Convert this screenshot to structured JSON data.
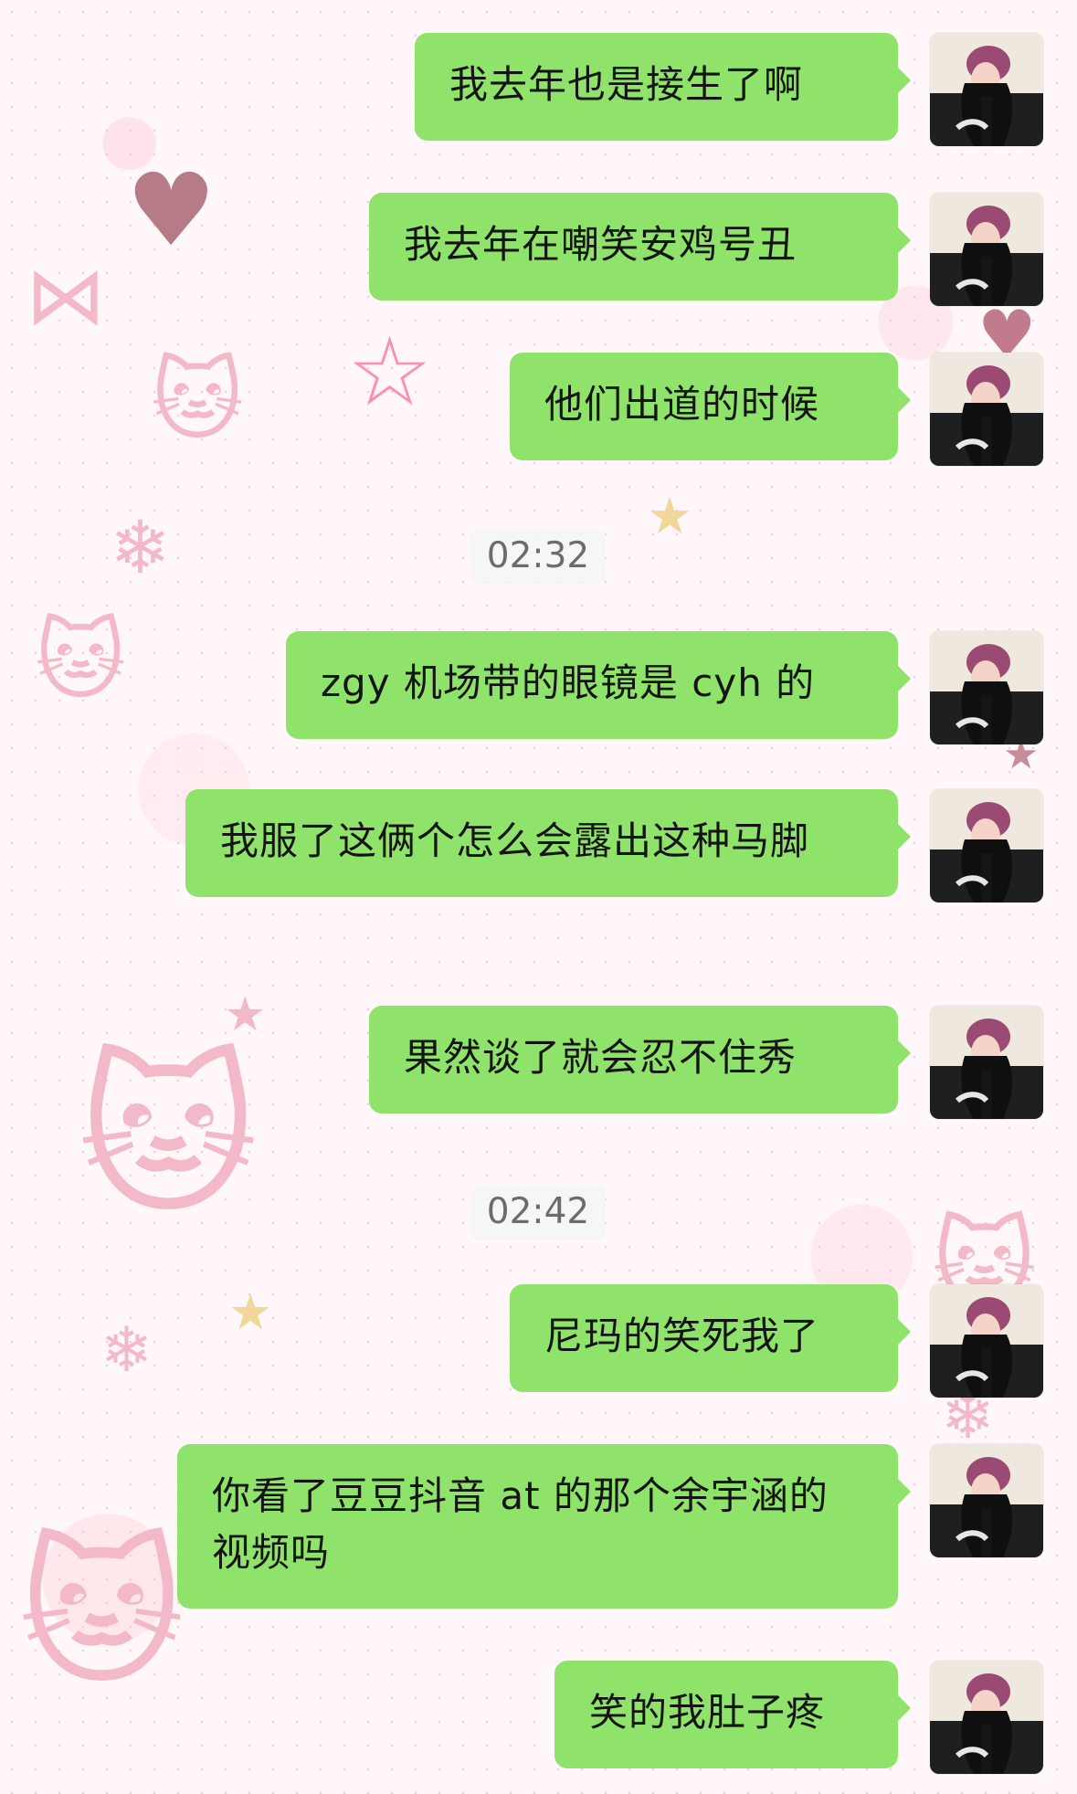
{
  "chat": {
    "messages": [
      {
        "type": "message",
        "text": "我去年也是接生了啊"
      },
      {
        "type": "message",
        "text": "我去年在嘲笑安鸡号丑"
      },
      {
        "type": "message",
        "text": "他们出道的时候"
      },
      {
        "type": "time",
        "text": "02:32"
      },
      {
        "type": "message",
        "text": "zgy 机场带的眼镜是 cyh 的"
      },
      {
        "type": "message",
        "text": "我服了这俩个怎么会露出这种马脚"
      },
      {
        "type": "message",
        "text": "果然谈了就会忍不住秀"
      },
      {
        "type": "time",
        "text": "02:42"
      },
      {
        "type": "message",
        "text": "尼玛的笑死我了"
      },
      {
        "type": "message",
        "text": "你看了豆豆抖音 at 的那个余宇涵的视频吗"
      },
      {
        "type": "message",
        "text": "笑的我肚子疼"
      }
    ]
  },
  "ui": {
    "bubble_color": "#8fe36a",
    "time_badge_bg": "#f5f5f5",
    "avatar_icon": "user-avatar-icon"
  }
}
